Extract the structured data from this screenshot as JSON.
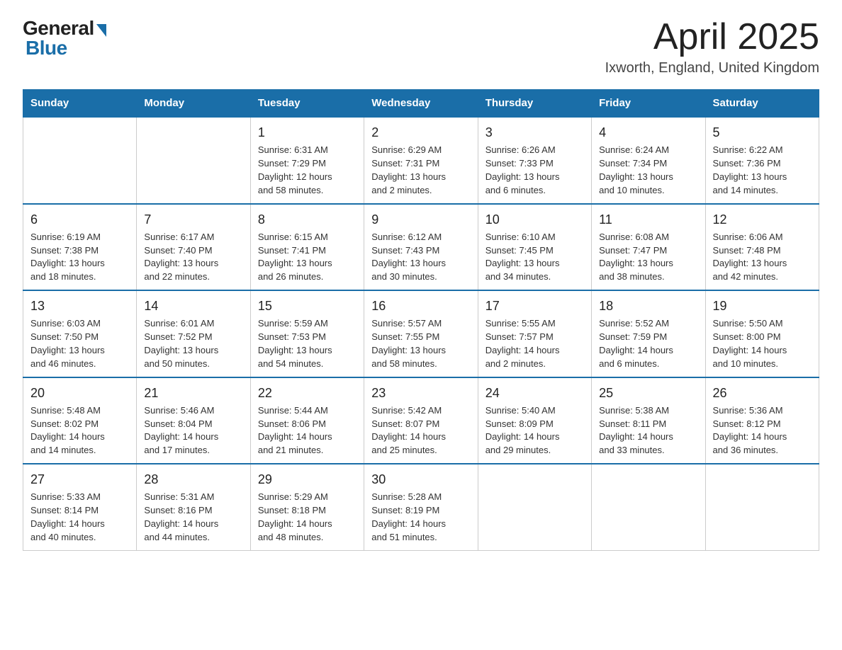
{
  "header": {
    "title": "April 2025",
    "location": "Ixworth, England, United Kingdom",
    "logo_general": "General",
    "logo_blue": "Blue"
  },
  "days_of_week": [
    "Sunday",
    "Monday",
    "Tuesday",
    "Wednesday",
    "Thursday",
    "Friday",
    "Saturday"
  ],
  "weeks": [
    [
      {
        "day": "",
        "info": ""
      },
      {
        "day": "",
        "info": ""
      },
      {
        "day": "1",
        "info": "Sunrise: 6:31 AM\nSunset: 7:29 PM\nDaylight: 12 hours\nand 58 minutes."
      },
      {
        "day": "2",
        "info": "Sunrise: 6:29 AM\nSunset: 7:31 PM\nDaylight: 13 hours\nand 2 minutes."
      },
      {
        "day": "3",
        "info": "Sunrise: 6:26 AM\nSunset: 7:33 PM\nDaylight: 13 hours\nand 6 minutes."
      },
      {
        "day": "4",
        "info": "Sunrise: 6:24 AM\nSunset: 7:34 PM\nDaylight: 13 hours\nand 10 minutes."
      },
      {
        "day": "5",
        "info": "Sunrise: 6:22 AM\nSunset: 7:36 PM\nDaylight: 13 hours\nand 14 minutes."
      }
    ],
    [
      {
        "day": "6",
        "info": "Sunrise: 6:19 AM\nSunset: 7:38 PM\nDaylight: 13 hours\nand 18 minutes."
      },
      {
        "day": "7",
        "info": "Sunrise: 6:17 AM\nSunset: 7:40 PM\nDaylight: 13 hours\nand 22 minutes."
      },
      {
        "day": "8",
        "info": "Sunrise: 6:15 AM\nSunset: 7:41 PM\nDaylight: 13 hours\nand 26 minutes."
      },
      {
        "day": "9",
        "info": "Sunrise: 6:12 AM\nSunset: 7:43 PM\nDaylight: 13 hours\nand 30 minutes."
      },
      {
        "day": "10",
        "info": "Sunrise: 6:10 AM\nSunset: 7:45 PM\nDaylight: 13 hours\nand 34 minutes."
      },
      {
        "day": "11",
        "info": "Sunrise: 6:08 AM\nSunset: 7:47 PM\nDaylight: 13 hours\nand 38 minutes."
      },
      {
        "day": "12",
        "info": "Sunrise: 6:06 AM\nSunset: 7:48 PM\nDaylight: 13 hours\nand 42 minutes."
      }
    ],
    [
      {
        "day": "13",
        "info": "Sunrise: 6:03 AM\nSunset: 7:50 PM\nDaylight: 13 hours\nand 46 minutes."
      },
      {
        "day": "14",
        "info": "Sunrise: 6:01 AM\nSunset: 7:52 PM\nDaylight: 13 hours\nand 50 minutes."
      },
      {
        "day": "15",
        "info": "Sunrise: 5:59 AM\nSunset: 7:53 PM\nDaylight: 13 hours\nand 54 minutes."
      },
      {
        "day": "16",
        "info": "Sunrise: 5:57 AM\nSunset: 7:55 PM\nDaylight: 13 hours\nand 58 minutes."
      },
      {
        "day": "17",
        "info": "Sunrise: 5:55 AM\nSunset: 7:57 PM\nDaylight: 14 hours\nand 2 minutes."
      },
      {
        "day": "18",
        "info": "Sunrise: 5:52 AM\nSunset: 7:59 PM\nDaylight: 14 hours\nand 6 minutes."
      },
      {
        "day": "19",
        "info": "Sunrise: 5:50 AM\nSunset: 8:00 PM\nDaylight: 14 hours\nand 10 minutes."
      }
    ],
    [
      {
        "day": "20",
        "info": "Sunrise: 5:48 AM\nSunset: 8:02 PM\nDaylight: 14 hours\nand 14 minutes."
      },
      {
        "day": "21",
        "info": "Sunrise: 5:46 AM\nSunset: 8:04 PM\nDaylight: 14 hours\nand 17 minutes."
      },
      {
        "day": "22",
        "info": "Sunrise: 5:44 AM\nSunset: 8:06 PM\nDaylight: 14 hours\nand 21 minutes."
      },
      {
        "day": "23",
        "info": "Sunrise: 5:42 AM\nSunset: 8:07 PM\nDaylight: 14 hours\nand 25 minutes."
      },
      {
        "day": "24",
        "info": "Sunrise: 5:40 AM\nSunset: 8:09 PM\nDaylight: 14 hours\nand 29 minutes."
      },
      {
        "day": "25",
        "info": "Sunrise: 5:38 AM\nSunset: 8:11 PM\nDaylight: 14 hours\nand 33 minutes."
      },
      {
        "day": "26",
        "info": "Sunrise: 5:36 AM\nSunset: 8:12 PM\nDaylight: 14 hours\nand 36 minutes."
      }
    ],
    [
      {
        "day": "27",
        "info": "Sunrise: 5:33 AM\nSunset: 8:14 PM\nDaylight: 14 hours\nand 40 minutes."
      },
      {
        "day": "28",
        "info": "Sunrise: 5:31 AM\nSunset: 8:16 PM\nDaylight: 14 hours\nand 44 minutes."
      },
      {
        "day": "29",
        "info": "Sunrise: 5:29 AM\nSunset: 8:18 PM\nDaylight: 14 hours\nand 48 minutes."
      },
      {
        "day": "30",
        "info": "Sunrise: 5:28 AM\nSunset: 8:19 PM\nDaylight: 14 hours\nand 51 minutes."
      },
      {
        "day": "",
        "info": ""
      },
      {
        "day": "",
        "info": ""
      },
      {
        "day": "",
        "info": ""
      }
    ]
  ]
}
